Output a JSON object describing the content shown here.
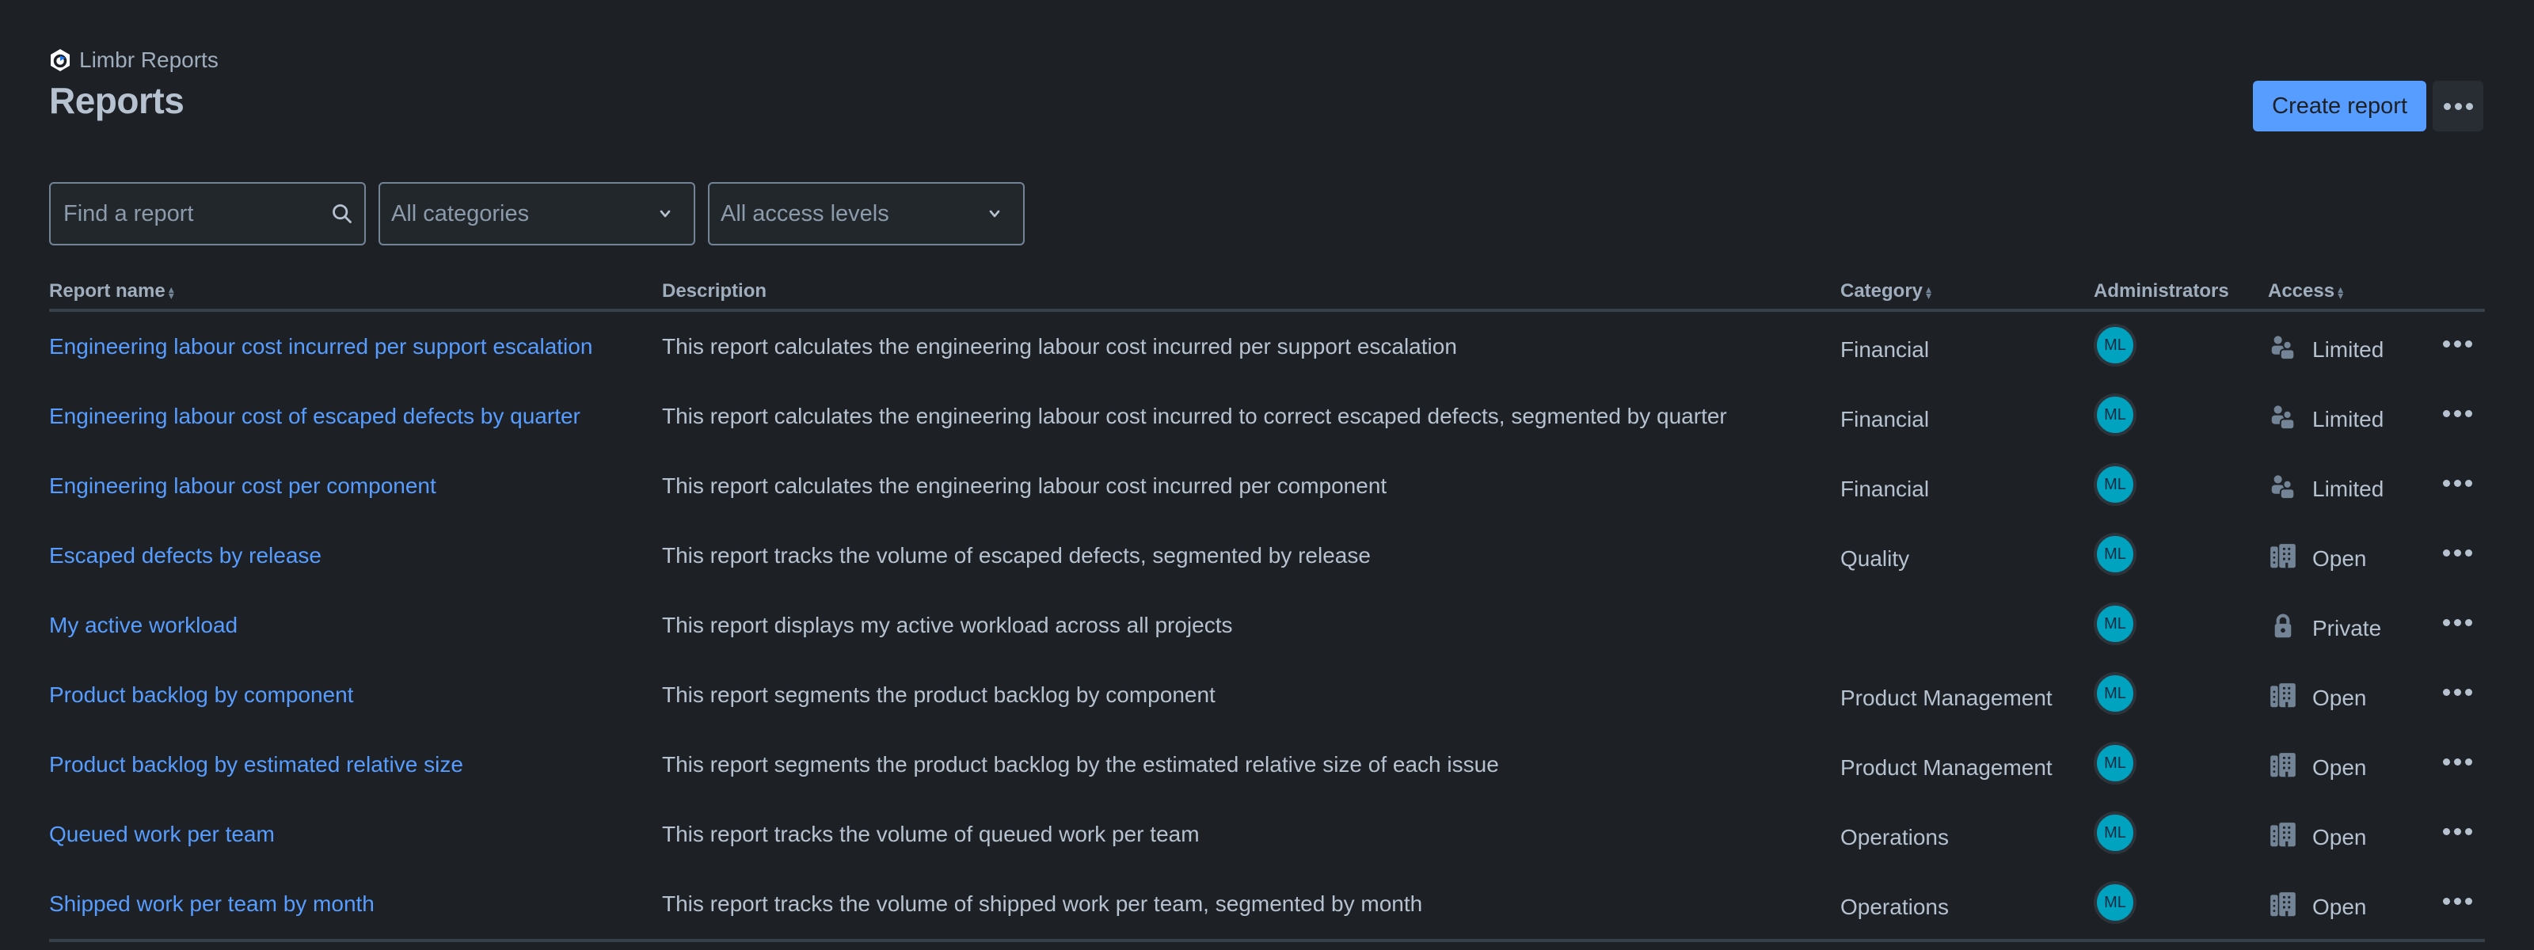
{
  "app": {
    "name": "Limbr Reports",
    "logo_icon": "limbr-hexagon-logo",
    "accent_color": "#579dff"
  },
  "header": {
    "title": "Reports",
    "create_button": "Create report",
    "more_icon": "more-horizontal-icon"
  },
  "filters": {
    "search_placeholder": "Find a report",
    "search_value": "",
    "category_selected": "All categories",
    "access_selected": "All access levels"
  },
  "table": {
    "columns": {
      "name": "Report name",
      "description": "Description",
      "category": "Category",
      "administrators": "Administrators",
      "access": "Access"
    },
    "rows": [
      {
        "name": "Engineering labour cost incurred per support escalation",
        "description": "This report calculates the engineering labour cost incurred per support escalation",
        "category": "Financial",
        "admin": "ML",
        "access": "Limited",
        "access_icon": "people-icon"
      },
      {
        "name": "Engineering labour cost of escaped defects by quarter",
        "description": "This report calculates the engineering labour cost incurred to correct escaped defects, segmented by quarter",
        "category": "Financial",
        "admin": "ML",
        "access": "Limited",
        "access_icon": "people-icon"
      },
      {
        "name": "Engineering labour cost per component",
        "description": "This report calculates the engineering labour cost incurred per component",
        "category": "Financial",
        "admin": "ML",
        "access": "Limited",
        "access_icon": "people-icon"
      },
      {
        "name": "Escaped defects by release",
        "description": "This report tracks the volume of escaped defects, segmented by release",
        "category": "Quality",
        "admin": "ML",
        "access": "Open",
        "access_icon": "building-icon"
      },
      {
        "name": "My active workload",
        "description": "This report displays my active workload across all projects",
        "category": "",
        "admin": "ML",
        "access": "Private",
        "access_icon": "lock-icon"
      },
      {
        "name": "Product backlog by component",
        "description": "This report segments the product backlog by component",
        "category": "Product Management",
        "admin": "ML",
        "access": "Open",
        "access_icon": "building-icon"
      },
      {
        "name": "Product backlog by estimated relative size",
        "description": "This report segments the product backlog by the estimated relative size of each issue",
        "category": "Product Management",
        "admin": "ML",
        "access": "Open",
        "access_icon": "building-icon"
      },
      {
        "name": "Queued work per team",
        "description": "This report tracks the volume of queued work per team",
        "category": "Operations",
        "admin": "ML",
        "access": "Open",
        "access_icon": "building-icon"
      },
      {
        "name": "Shipped work per team by month",
        "description": "This report tracks the volume of shipped work per team, segmented by month",
        "category": "Operations",
        "admin": "ML",
        "access": "Open",
        "access_icon": "building-icon"
      }
    ]
  }
}
